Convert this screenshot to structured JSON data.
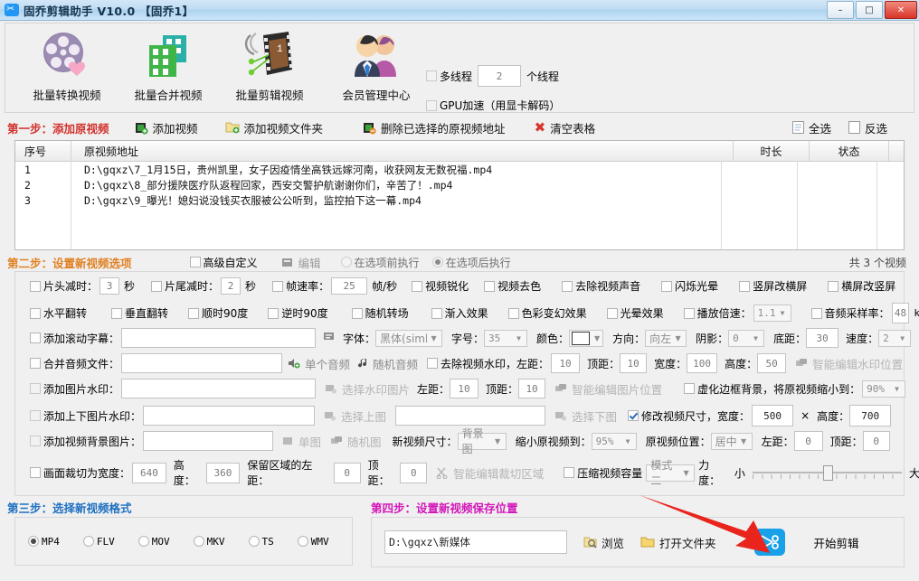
{
  "window": {
    "title": "固乔剪辑助手 V10.0  【固乔1】",
    "icon": "scissors-icon",
    "buttons": {
      "minimize": "–",
      "maximize": "□",
      "close": "✕"
    }
  },
  "toolbar": {
    "items": [
      {
        "label": "批量转换视频",
        "icon": "film-reel-icon"
      },
      {
        "label": "批量合并视频",
        "icon": "green-buildings-icon"
      },
      {
        "label": "批量剪辑视频",
        "icon": "film-strip-icon"
      },
      {
        "label": "会员管理中心",
        "icon": "members-icon"
      }
    ],
    "multithread_label": "多线程",
    "multithread_checked": false,
    "thread_count": "2",
    "thread_unit": "个线程",
    "gpu_label": "GPU加速（用显卡解码）",
    "gpu_checked": false
  },
  "step1": {
    "title": "第一步：添加原视频",
    "add_video": "添加视频",
    "add_folder": "添加视频文件夹",
    "delete_selected": "删除已选择的原视频地址",
    "clear_table": "清空表格",
    "select_all": "全选",
    "invert_select": "反选"
  },
  "table": {
    "headers": {
      "index": "序号",
      "path": "原视频地址",
      "duration": "时长",
      "status": "状态"
    },
    "rows": [
      {
        "index": "1",
        "path": "D:\\gqxz\\7_1月15日，贵州凯里，女子因疫情坐高铁远嫁河南，收获网友无数祝福.mp4",
        "duration": "",
        "status": ""
      },
      {
        "index": "2",
        "path": "D:\\gqxz\\8_部分援陕医疗队返程回家，西安交警护航谢谢你们，辛苦了！.mp4",
        "duration": "",
        "status": ""
      },
      {
        "index": "3",
        "path": "D:\\gqxz\\9_曝光！媳妇说没钱买衣服被公公听到，监控拍下这一幕.mp4",
        "duration": "",
        "status": ""
      }
    ],
    "count_text": "共 3 个视频"
  },
  "step2": {
    "title": "第二步：设置新视频选项",
    "advanced_label": "高级自定义",
    "advanced_checked": false,
    "edit_label": "编辑",
    "before_label": "在选项前执行",
    "before_checked": false,
    "after_label": "在选项后执行",
    "after_checked": true
  },
  "options": {
    "row1": {
      "head_trim_label": "片头减时：",
      "head_trim_value": "3",
      "head_trim_unit": "秒",
      "tail_trim_label": "片尾减时：",
      "tail_trim_value": "2",
      "tail_trim_unit": "秒",
      "fps_label": "帧速率：",
      "fps_value": "25",
      "fps_unit": "帧/秒",
      "sharpen": "视频锐化",
      "decolor": "视频去色",
      "remove_audio": "去除视频声音",
      "flicker_halo": "闪烁光晕",
      "v2h": "竖屏改横屏",
      "h2v": "横屏改竖屏"
    },
    "row2": {
      "flip_h": "水平翻转",
      "flip_v": "垂直翻转",
      "rotate_cw": "顺时90度",
      "rotate_ccw": "逆时90度",
      "random_transition": "随机转场",
      "fade_in": "渐入效果",
      "color_shift": "色彩变幻效果",
      "halo_effect": "光晕效果",
      "speed_label": "播放倍速：",
      "speed_value": "1.1",
      "samplerate_label": "音频采样率：",
      "samplerate_value": "48",
      "samplerate_unit": "k"
    },
    "row3": {
      "subtitle_label": "添加滚动字幕：",
      "subtitle_value": "",
      "edit_icon": "subtitle-edit-icon",
      "font_label": "字体：",
      "font_value": "黑体(simhei)",
      "size_label": "字号：",
      "size_value": "35",
      "color_label": "颜色：",
      "color_value": "#ffffff",
      "direction_label": "方向：",
      "direction_value": "向左",
      "shadow_label": "阴影：",
      "shadow_value": "0",
      "bottom_label": "底距：",
      "bottom_value": "30",
      "speed_label": "速度：",
      "speed_value": "2"
    },
    "row4": {
      "merge_audio_label": "合并音频文件：",
      "merge_audio_value": "",
      "single_audio": "单个音频",
      "random_audio": "随机音频",
      "remove_watermark": "去除视频水印，左距：",
      "left_value": "10",
      "top_label": "顶距：",
      "top_value": "10",
      "width_label": "宽度：",
      "width_value": "100",
      "height_label": "高度：",
      "height_value": "50",
      "smart_watermark": "智能编辑水印位置"
    },
    "row5": {
      "image_watermark_label": "添加图片水印：",
      "image_watermark_value": "",
      "choose_watermark": "选择水印图片",
      "left_label": "左距：",
      "left_value": "10",
      "top_label": "顶距：",
      "top_value": "10",
      "smart_image": "智能编辑图片位置",
      "blur_bg_label": "虚化边框背景，将原视频缩小到：",
      "blur_bg_value": "90%"
    },
    "row6": {
      "tb_watermark_label": "添加上下图片水印：",
      "top_image_value": "",
      "choose_top": "选择上图",
      "bottom_image_value": "",
      "choose_bottom": "选择下图",
      "resize_label": "修改视频尺寸，宽度：",
      "resize_checked": true,
      "width_value": "500",
      "times": "×",
      "height_label": "高度：",
      "height_value": "700"
    },
    "row7": {
      "bg_image_label": "添加视频背景图片：",
      "bg_image_value": "",
      "single_image": "单图",
      "random_image": "随机图",
      "new_size_label": "新视频尺寸：",
      "new_size_value": "背景图",
      "shrink_label": "缩小原视频到：",
      "shrink_value": "95%",
      "position_label": "原视频位置：",
      "position_value": "居中",
      "left_label": "左距：",
      "left_value": "0",
      "top_label": "顶距：",
      "top_value": "0"
    },
    "row8": {
      "crop_label": "画面裁切为宽度：",
      "crop_width": "640",
      "height_label": "高度：",
      "crop_height": "360",
      "keep_left_label": "保留区域的左距：",
      "keep_left": "0",
      "keep_top_label": "顶距：",
      "keep_top": "0",
      "smart_crop": "智能编辑裁切区域",
      "compress_label": "压缩视频容量",
      "mode_value": "模式二",
      "strength_label": "力度：",
      "small": "小",
      "large": "大"
    }
  },
  "step3": {
    "title": "第三步：选择新视频格式",
    "formats": [
      {
        "label": "MP4",
        "checked": true
      },
      {
        "label": "FLV",
        "checked": false
      },
      {
        "label": "MOV",
        "checked": false
      },
      {
        "label": "MKV",
        "checked": false
      },
      {
        "label": "TS",
        "checked": false
      },
      {
        "label": "WMV",
        "checked": false
      }
    ]
  },
  "step4": {
    "title": "第四步：设置新视频保存位置",
    "save_path": "D:\\gqxz\\新媒体",
    "browse": "浏览",
    "open_folder": "打开文件夹",
    "start_button": "开始剪辑",
    "start_icon": "scissors-icon",
    "accent_color": "#18a0e8",
    "arrow_color": "#e8241c"
  }
}
